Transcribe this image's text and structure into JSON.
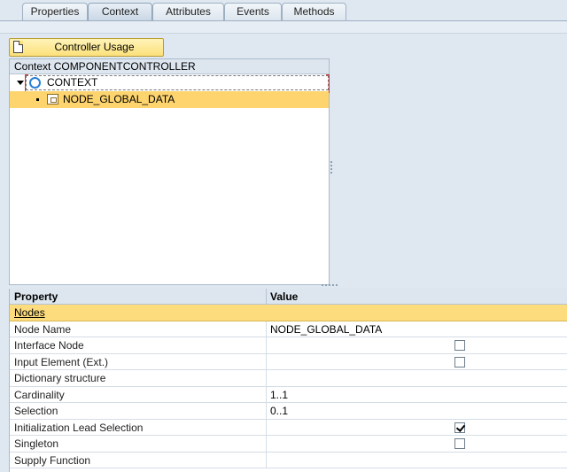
{
  "tabs": [
    {
      "label": "Properties",
      "active": false
    },
    {
      "label": "Context",
      "active": true
    },
    {
      "label": "Attributes",
      "active": false
    },
    {
      "label": "Events",
      "active": false
    },
    {
      "label": "Methods",
      "active": false
    }
  ],
  "toolbar": {
    "controller_usage_label": "Controller Usage",
    "icon": "document-icon"
  },
  "tree": {
    "header": "Context COMPONENTCONTROLLER",
    "root": {
      "label": "CONTEXT",
      "icon": "context-circle-icon"
    },
    "child": {
      "label": "NODE_GLOBAL_DATA",
      "icon": "node-icon"
    }
  },
  "props": {
    "header_property": "Property",
    "header_value": "Value",
    "group": "Nodes",
    "rows": [
      {
        "label": "Node Name",
        "value": "NODE_GLOBAL_DATA"
      },
      {
        "label": "Interface Node",
        "checked": false
      },
      {
        "label": "Input Element (Ext.)",
        "checked": false
      },
      {
        "label": "Dictionary structure",
        "value": ""
      },
      {
        "label": "Cardinality",
        "value": "1..1"
      },
      {
        "label": "Selection",
        "value": "0..1"
      },
      {
        "label": "Initialization Lead Selection",
        "checked": true
      },
      {
        "label": "Singleton",
        "checked": false
      },
      {
        "label": "Supply Function",
        "value": ""
      }
    ]
  },
  "colors": {
    "selection": "#fdd46e",
    "button": "#fbe07b",
    "background": "#dfe8f1"
  }
}
